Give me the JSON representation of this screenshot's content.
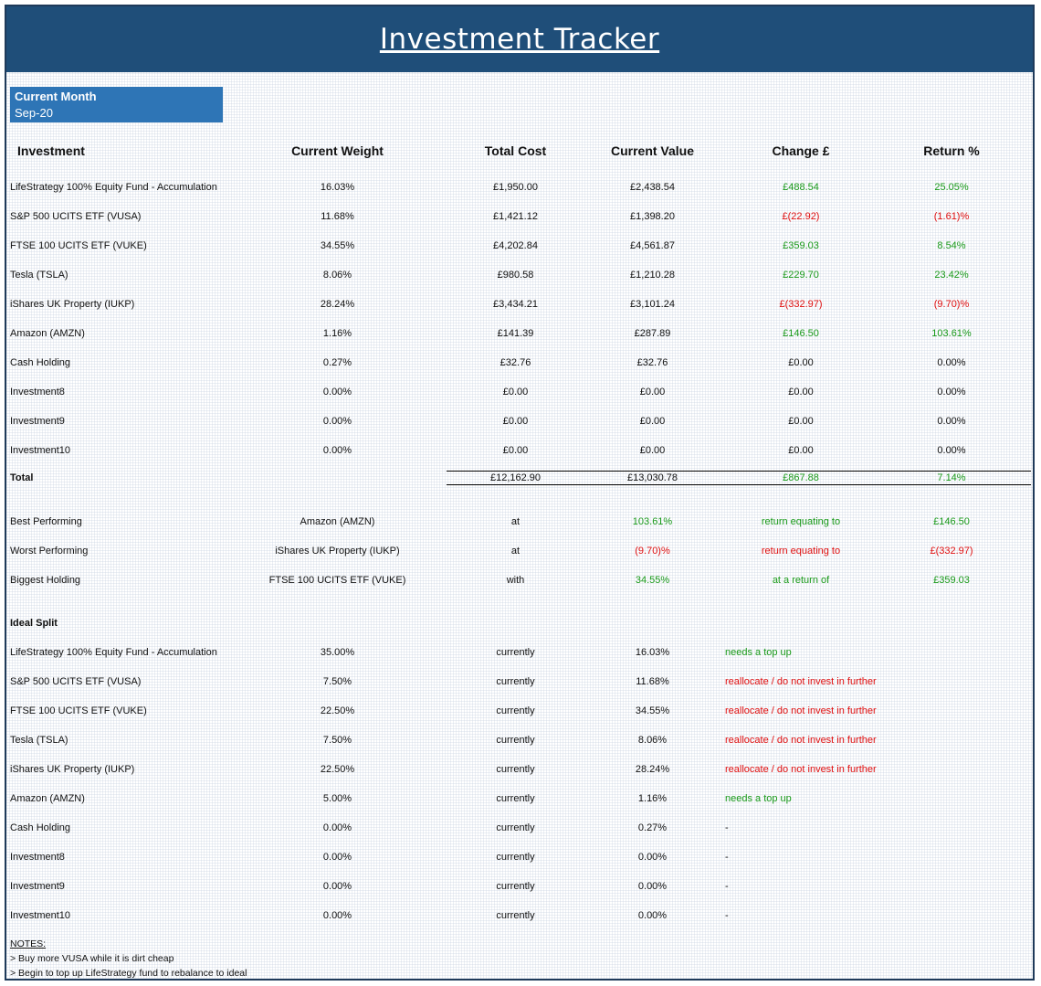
{
  "title": "Investment Tracker",
  "current_month": {
    "label": "Current Month",
    "value": "Sep-20"
  },
  "headers": [
    "Investment",
    "Current Weight",
    "Total Cost",
    "Current Value",
    "Change £",
    "Return %"
  ],
  "holdings": [
    {
      "name": "LifeStrategy 100% Equity Fund - Accumulation",
      "weight": "16.03%",
      "cost": "£1,950.00",
      "value": "£2,438.54",
      "change": "£488.54",
      "ret": "25.05%",
      "status": "pos"
    },
    {
      "name": "S&P 500 UCITS ETF (VUSA)",
      "weight": "11.68%",
      "cost": "£1,421.12",
      "value": "£1,398.20",
      "change": "£(22.92)",
      "ret": "(1.61)%",
      "status": "neg"
    },
    {
      "name": "FTSE 100 UCITS ETF (VUKE)",
      "weight": "34.55%",
      "cost": "£4,202.84",
      "value": "£4,561.87",
      "change": "£359.03",
      "ret": "8.54%",
      "status": "pos"
    },
    {
      "name": "Tesla (TSLA)",
      "weight": "8.06%",
      "cost": "£980.58",
      "value": "£1,210.28",
      "change": "£229.70",
      "ret": "23.42%",
      "status": "pos"
    },
    {
      "name": "iShares UK Property (IUKP)",
      "weight": "28.24%",
      "cost": "£3,434.21",
      "value": "£3,101.24",
      "change": "£(332.97)",
      "ret": "(9.70)%",
      "status": "neg"
    },
    {
      "name": "Amazon (AMZN)",
      "weight": "1.16%",
      "cost": "£141.39",
      "value": "£287.89",
      "change": "£146.50",
      "ret": "103.61%",
      "status": "pos"
    },
    {
      "name": "Cash Holding",
      "weight": "0.27%",
      "cost": "£32.76",
      "value": "£32.76",
      "change": "£0.00",
      "ret": "0.00%",
      "status": "none"
    },
    {
      "name": "Investment8",
      "weight": "0.00%",
      "cost": "£0.00",
      "value": "£0.00",
      "change": "£0.00",
      "ret": "0.00%",
      "status": "none"
    },
    {
      "name": "Investment9",
      "weight": "0.00%",
      "cost": "£0.00",
      "value": "£0.00",
      "change": "£0.00",
      "ret": "0.00%",
      "status": "none"
    },
    {
      "name": "Investment10",
      "weight": "0.00%",
      "cost": "£0.00",
      "value": "£0.00",
      "change": "£0.00",
      "ret": "0.00%",
      "status": "none"
    }
  ],
  "total": {
    "label": "Total",
    "cost": "£12,162.90",
    "value": "£13,030.78",
    "change": "£867.88",
    "ret": "7.14%"
  },
  "performance": [
    {
      "label": "Best Performing",
      "name": "Amazon (AMZN)",
      "conj": "at",
      "pct": "103.61%",
      "phrase": "return equating to",
      "amount": "£146.50",
      "status": "pos"
    },
    {
      "label": "Worst Performing",
      "name": "iShares UK Property (IUKP)",
      "conj": "at",
      "pct": "(9.70)%",
      "phrase": "return equating to",
      "amount": "£(332.97)",
      "status": "neg"
    },
    {
      "label": "Biggest Holding",
      "name": "FTSE 100 UCITS ETF (VUKE)",
      "conj": "with",
      "pct": "34.55%",
      "phrase": "at a return of",
      "amount": "£359.03",
      "status": "pos"
    }
  ],
  "ideal_split_title": "Ideal Split",
  "ideal_split": [
    {
      "name": "LifeStrategy 100% Equity Fund - Accumulation",
      "target": "35.00%",
      "conj": "currently",
      "current": "16.03%",
      "advice": "needs a top up",
      "status": "pos"
    },
    {
      "name": "S&P 500 UCITS ETF (VUSA)",
      "target": "7.50%",
      "conj": "currently",
      "current": "11.68%",
      "advice": "reallocate / do not invest in further",
      "status": "neg"
    },
    {
      "name": "FTSE 100 UCITS ETF (VUKE)",
      "target": "22.50%",
      "conj": "currently",
      "current": "34.55%",
      "advice": "reallocate / do not invest in further",
      "status": "neg"
    },
    {
      "name": "Tesla (TSLA)",
      "target": "7.50%",
      "conj": "currently",
      "current": "8.06%",
      "advice": "reallocate / do not invest in further",
      "status": "neg"
    },
    {
      "name": "iShares UK Property (IUKP)",
      "target": "22.50%",
      "conj": "currently",
      "current": "28.24%",
      "advice": "reallocate / do not invest in further",
      "status": "neg"
    },
    {
      "name": "Amazon (AMZN)",
      "target": "5.00%",
      "conj": "currently",
      "current": "1.16%",
      "advice": "needs a top up",
      "status": "pos"
    },
    {
      "name": "Cash Holding",
      "target": "0.00%",
      "conj": "currently",
      "current": "0.27%",
      "advice": "-",
      "status": "none"
    },
    {
      "name": "Investment8",
      "target": "0.00%",
      "conj": "currently",
      "current": "0.00%",
      "advice": "-",
      "status": "none"
    },
    {
      "name": "Investment9",
      "target": "0.00%",
      "conj": "currently",
      "current": "0.00%",
      "advice": "-",
      "status": "none"
    },
    {
      "name": "Investment10",
      "target": "0.00%",
      "conj": "currently",
      "current": "0.00%",
      "advice": "-",
      "status": "none"
    }
  ],
  "notes": {
    "title": "NOTES:",
    "lines": [
      "> Buy more VUSA while it is dirt cheap",
      "> Begin to top up LifeStrategy fund to rebalance to ideal"
    ]
  }
}
